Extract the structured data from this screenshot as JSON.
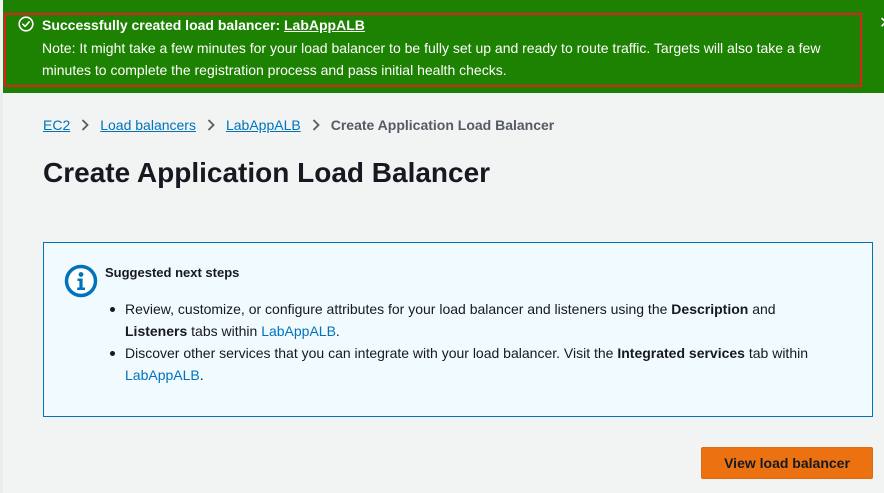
{
  "flash": {
    "title_prefix": "Successfully created load balancer: ",
    "title_link": "LabAppALB",
    "note": "Note: It might take a few minutes for your load balancer to be fully set up and ready to route traffic. Targets will also take a few minutes to complete the registration process and pass initial health checks.",
    "status_icon": "check-circle-icon",
    "close_icon": "close-icon",
    "color": "#1d8102"
  },
  "breadcrumb": {
    "items": [
      "EC2",
      "Load balancers",
      "LabAppALB"
    ],
    "current": "Create Application Load Balancer"
  },
  "page": {
    "title": "Create Application Load Balancer"
  },
  "info": {
    "icon": "info-icon",
    "heading": "Suggested next steps",
    "bullet1": {
      "t1": "Review, customize, or configure attributes for your load balancer and listeners using the ",
      "b1": "Description",
      "t2": " and ",
      "b2": "Listeners",
      "t3": " tabs within ",
      "link": "LabAppALB",
      "t4": "."
    },
    "bullet2": {
      "t1": "Discover other services that you can integrate with your load balancer. Visit the ",
      "b1": "Integrated services",
      "t2": " tab within ",
      "link": "LabAppALB",
      "t3": "."
    }
  },
  "actions": {
    "view_label": "View load balancer",
    "accent": "#ec7211"
  }
}
